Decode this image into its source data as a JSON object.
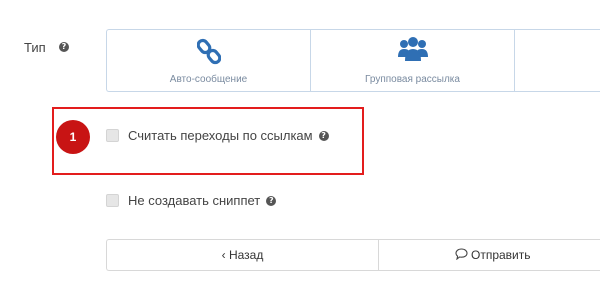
{
  "type_field": {
    "label": "Тип",
    "options": [
      {
        "label": "Авто-сообщение",
        "icon": "link-icon"
      },
      {
        "label": "Групповая рассылка",
        "icon": "users-icon"
      },
      {
        "label": "",
        "icon": ""
      }
    ]
  },
  "step_badge": "1",
  "options": {
    "track_clicks_label": "Считать переходы по ссылкам",
    "no_snippet_label": "Не создавать сниппет"
  },
  "actions": {
    "back_label": "‹ Назад",
    "send_label": "Отправить"
  },
  "colors": {
    "accent_blue": "#2f6fb4",
    "highlight_red": "#e31d1d",
    "badge_red": "#c81414",
    "option_text": "#7a8ba0"
  }
}
